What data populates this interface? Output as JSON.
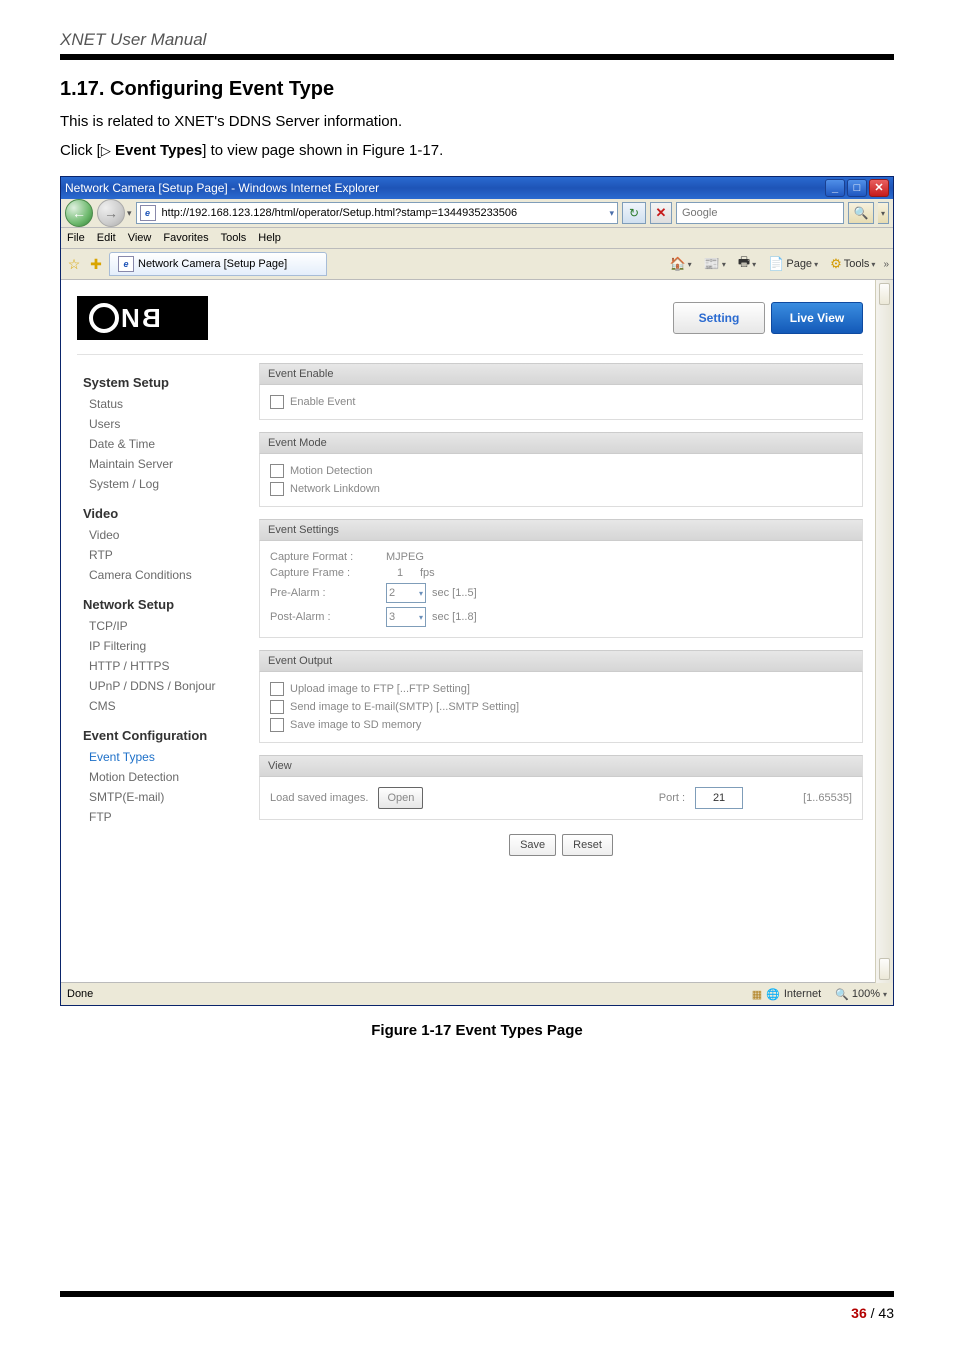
{
  "doc": {
    "header": "XNET User Manual",
    "section_title": "1.17. Configuring Event Type",
    "intro1": "This is related to XNET's DDNS Server information.",
    "click_prefix": "Click [",
    "event_types_label": "Event Types",
    "click_suffix": "] to view page shown in Figure 1-17.",
    "figure_caption": "Figure 1-17 Event Types Page",
    "page_current": "36",
    "page_sep": " / ",
    "page_total": "43"
  },
  "browser": {
    "title": "Network Camera [Setup Page] - Windows Internet Explorer",
    "url": "http://192.168.123.128/html/operator/Setup.html?stamp=1344935233506",
    "search_placeholder": "Google",
    "menubar": [
      "File",
      "Edit",
      "View",
      "Favorites",
      "Tools",
      "Help"
    ],
    "tab_label": "Network Camera [Setup Page]",
    "tool_home": "",
    "tool_feed": "",
    "tool_print": "",
    "tool_page": "Page",
    "tool_tools": "Tools",
    "status_done": "Done",
    "zone_text": "Internet",
    "zoom": "100%"
  },
  "cnb": {
    "setting": "Setting",
    "live_view": "Live View",
    "menu": {
      "system_setup": "System Setup",
      "status": "Status",
      "users": "Users",
      "date_time": "Date & Time",
      "maintain_server": "Maintain Server",
      "system_log": "System / Log",
      "video_head": "Video",
      "video": "Video",
      "rtp": "RTP",
      "camera_conditions": "Camera Conditions",
      "network_setup": "Network Setup",
      "tcpip": "TCP/IP",
      "ip_filtering": "IP Filtering",
      "http_https": "HTTP / HTTPS",
      "upnp": "UPnP / DDNS / Bonjour",
      "cms": "CMS",
      "event_configuration": "Event Configuration",
      "event_types": "Event Types",
      "motion_detection": "Motion Detection",
      "smtp": "SMTP(E-mail)",
      "ftp": "FTP"
    },
    "panel": {
      "event_enable": "Event Enable",
      "enable_event": "Enable Event",
      "event_mode": "Event Mode",
      "motion_detection": "Motion Detection",
      "network_linkdown": "Network Linkdown",
      "event_settings": "Event Settings",
      "capture_format": "Capture Format :",
      "capture_format_val": "MJPEG",
      "capture_frame": "Capture Frame :",
      "capture_frame_val": "1",
      "capture_frame_unit": "fps",
      "pre_alarm": "Pre-Alarm :",
      "pre_alarm_val": "2",
      "pre_alarm_unit": "sec [1..5]",
      "post_alarm": "Post-Alarm :",
      "post_alarm_val": "3",
      "post_alarm_unit": "sec [1..8]",
      "event_output": "Event Output",
      "upload_ftp": "Upload image to FTP   [...FTP Setting]",
      "send_smtp": "Send image to E-mail(SMTP)   [...SMTP Setting]",
      "save_sd": "Save image to SD memory",
      "view": "View",
      "load_saved": "Load saved images.",
      "open": "Open",
      "port_label": "Port :",
      "port_val": "21",
      "port_range": "[1..65535]",
      "save": "Save",
      "reset": "Reset"
    }
  }
}
